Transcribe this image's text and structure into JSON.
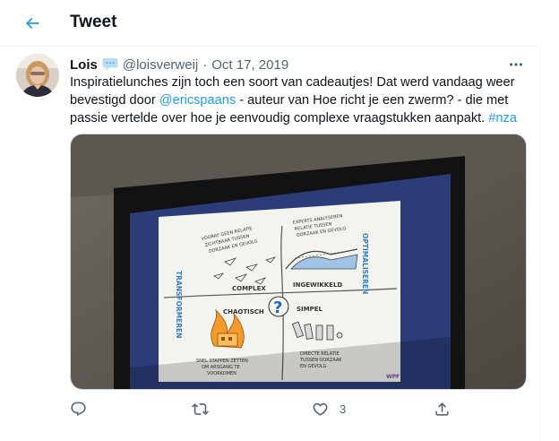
{
  "header": {
    "title": "Tweet"
  },
  "tweet": {
    "display_name": "Lois",
    "handle": "@loisverweij",
    "separator": "·",
    "date": "Oct 17, 2019",
    "text": {
      "part1": "Inspiratielunches zijn toch een soort van cadeautjes! Dat werd vandaag weer bevestigd door ",
      "mention": "@ericspaans",
      "part2": " - auteur van Hoe richt je een zwerm? - die met passie vertelde over hoe je eenvoudig complexe vraagstukken aanpakt. ",
      "hashtag": "#nza"
    },
    "likes_count": "3"
  },
  "slide": {
    "left_vertical": "TRANSFORMEREN",
    "right_vertical": "OPTIMALISEREN",
    "top_left": [
      "VOORAF GEEN RELATIE",
      "ZICHTBAAR TUSSEN",
      "OORZAAK EN GEVOLG"
    ],
    "top_right": [
      "EXPERTS ANALYSEREN",
      "RELATIE TUSSEN",
      "OORZAAK EN GEVOLG"
    ],
    "label_complex": "COMPLEX",
    "label_ingewikkeld": "INGEWIKKELD",
    "label_chaotisch": "CHAOTISCH",
    "label_simpel": "SIMPEL",
    "center_mark": "?",
    "bottom_left": [
      "SNEL STAPPEN ZETTEN",
      "OM ARSGANG TE",
      "VOORKOMEN"
    ],
    "bottom_right": [
      "DIRECTE RELATIE",
      "TUSSEN OORZAAK",
      "EN GEVOLG"
    ],
    "corner_mark": "WPF"
  },
  "icons": {
    "back": "arrow-left-icon",
    "badge": "speech-bubble-icon",
    "more": "more-horizontal-icon",
    "reply": "reply-icon",
    "retweet": "retweet-icon",
    "like": "heart-icon",
    "share": "share-icon"
  },
  "colors": {
    "accent": "#1d9bf0",
    "text": "#0f1419",
    "secondary": "#536471",
    "border": "#eff3f4"
  }
}
